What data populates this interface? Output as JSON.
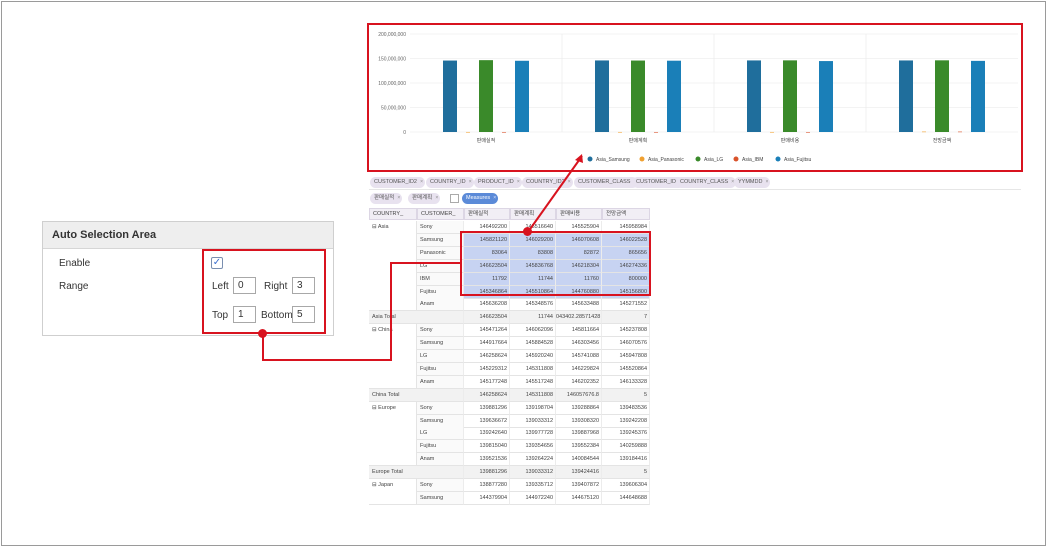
{
  "panel": {
    "title": "Auto Selection Area",
    "enable_label": "Enable",
    "enable_checked": true,
    "range_label": "Range",
    "left_label": "Left",
    "left_value": "0",
    "right_label": "Right",
    "right_value": "3",
    "top_label": "Top",
    "top_value": "1",
    "bottom_label": "Bottom",
    "bottom_value": "5"
  },
  "colors": {
    "accent_red": "#d8131f",
    "selection": "#c7d3f2",
    "samsung": "#1f6e9c",
    "panasonic": "#f0a030",
    "lg": "#3a8a2a",
    "ibm": "#d9532b",
    "fujitsu": "#1a7fb8"
  },
  "chips": {
    "fields": [
      "CUSTOMER_ID2",
      "COUNTRY_ID",
      "PRODUCT_ID",
      "COUNTRY_ID2",
      "CUSTOMER_CLASS",
      "CUSTOMER_ID",
      "COUNTRY_CLASS",
      "YYMMDD"
    ],
    "measures": [
      "판매실적",
      "판매계획"
    ],
    "measures_button": "Measures"
  },
  "grid": {
    "headers": [
      "COUNTRY_",
      "CUSTOMER_",
      "판매실적",
      "판매계획",
      "판매비용",
      "전망금액"
    ],
    "groups": [
      {
        "region": "Asia",
        "rows": [
          {
            "customer": "Sony",
            "values": [
              "146492200",
              "145516640",
              "145525904",
              "145958984"
            ]
          },
          {
            "customer": "Samsung",
            "values": [
              "145821120",
              "146029200",
              "146070608",
              "146022528"
            ]
          },
          {
            "customer": "Panasonic",
            "values": [
              "83064",
              "83808",
              "82872",
              "865656"
            ]
          },
          {
            "customer": "LG",
            "values": [
              "146623504",
              "145836768",
              "146218304",
              "146274336"
            ]
          },
          {
            "customer": "IBM",
            "values": [
              "11792",
              "11744",
              "11760",
              "800000"
            ]
          },
          {
            "customer": "Fujitsu",
            "values": [
              "145346864",
              "145510864",
              "144760880",
              "145156800"
            ]
          },
          {
            "customer": "Anam",
            "values": [
              "145636208",
              "145348576",
              "145633488",
              "145271552"
            ]
          }
        ],
        "total_label": "Asia Total",
        "total": [
          "146623504",
          "11744",
          "043402.28571428",
          "7"
        ]
      },
      {
        "region": "China",
        "rows": [
          {
            "customer": "Sony",
            "values": [
              "145471264",
              "146062096",
              "145811664",
              "145237808"
            ]
          },
          {
            "customer": "Samsung",
            "values": [
              "144917664",
              "145884528",
              "146303456",
              "146070576"
            ]
          },
          {
            "customer": "LG",
            "values": [
              "146258624",
              "145920240",
              "145741088",
              "145947808"
            ]
          },
          {
            "customer": "Fujitsu",
            "values": [
              "145229312",
              "145311808",
              "146229824",
              "145520864"
            ]
          },
          {
            "customer": "Anam",
            "values": [
              "145177248",
              "145517248",
              "146202352",
              "146133328"
            ]
          }
        ],
        "total_label": "China Total",
        "total": [
          "146258624",
          "145311808",
          "146057676.8",
          "5"
        ]
      },
      {
        "region": "Europe",
        "rows": [
          {
            "customer": "Sony",
            "values": [
              "139881296",
              "139198704",
              "139288864",
              "139483536"
            ]
          },
          {
            "customer": "Samsung",
            "values": [
              "139636672",
              "139033312",
              "139308320",
              "139242208"
            ]
          },
          {
            "customer": "LG",
            "values": [
              "139242640",
              "139977728",
              "139887968",
              "139245376"
            ]
          },
          {
            "customer": "Fujitsu",
            "values": [
              "139815040",
              "139354656",
              "139552384",
              "140259888"
            ]
          },
          {
            "customer": "Anam",
            "values": [
              "139521536",
              "139264224",
              "140084544",
              "139184416"
            ]
          }
        ],
        "total_label": "Europe Total",
        "total": [
          "139881296",
          "139033312",
          "139424416",
          "5"
        ]
      },
      {
        "region": "Japan",
        "rows": [
          {
            "customer": "Sony",
            "values": [
              "138877280",
              "139335712",
              "139407872",
              "139606304"
            ]
          },
          {
            "customer": "Samsung",
            "values": [
              "144379904",
              "144972240",
              "144675120",
              "144648688"
            ]
          }
        ]
      }
    ]
  },
  "chart_data": {
    "type": "bar",
    "categories": [
      "판매실적",
      "판매계획",
      "판매비용",
      "전망금액"
    ],
    "ylim": [
      0,
      200000000
    ],
    "yticks": [
      "200,000,000",
      "150,000,000",
      "100,000,000",
      "50,000,000",
      "0"
    ],
    "series": [
      {
        "name": "Asia_Samsung",
        "color": "#1f6e9c",
        "values": [
          145821120,
          146029200,
          146070608,
          146022528
        ]
      },
      {
        "name": "Asia_Panasonic",
        "color": "#f0a030",
        "values": [
          83064,
          83808,
          82872,
          865656
        ]
      },
      {
        "name": "Asia_LG",
        "color": "#3a8a2a",
        "values": [
          146623504,
          145836768,
          146218304,
          146274336
        ]
      },
      {
        "name": "Asia_IBM",
        "color": "#d9532b",
        "values": [
          11792,
          11744,
          11760,
          800000
        ]
      },
      {
        "name": "Asia_Fujitsu",
        "color": "#1a7fb8",
        "values": [
          145346864,
          145510864,
          144760880,
          145156800
        ]
      }
    ],
    "legend_position": "bottom"
  }
}
